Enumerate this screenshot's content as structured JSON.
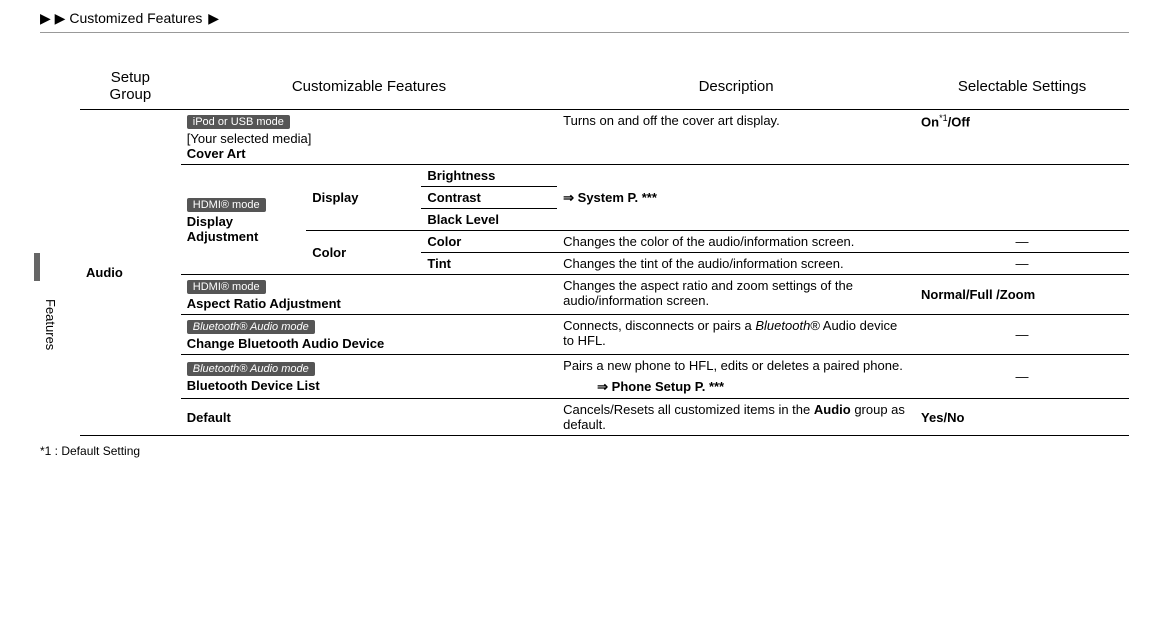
{
  "breadcrumb": {
    "arrows": "▶ ▶",
    "title": "Customized Features",
    "arrow_after": "▶"
  },
  "headers": {
    "setup_group": "Setup\nGroup",
    "customizable": "Customizable Features",
    "description": "Description",
    "selectable": "Selectable Settings"
  },
  "side_tab": "Features",
  "group": "Audio",
  "rows": {
    "cover_art": {
      "badge": "iPod or USB mode",
      "line1": "[Your selected media]",
      "line2": "Cover Art",
      "desc": "Turns on and off the cover art display.",
      "setting_on": "On",
      "setting_sup": "*1",
      "setting_off": "/Off"
    },
    "display_adj": {
      "badge": "HDMI® mode",
      "label": "Display Adjustment",
      "display": "Display",
      "color_group": "Color",
      "brightness": "Brightness",
      "contrast": "Contrast",
      "black_level": "Black Level",
      "color": "Color",
      "tint": "Tint",
      "system_ref": "⇒   System P. ***",
      "color_desc": "Changes the color of the audio/information screen.",
      "tint_desc": "Changes the tint of the audio/information screen.",
      "dash": "—"
    },
    "aspect": {
      "badge": "HDMI® mode",
      "label": "Aspect Ratio Adjustment",
      "desc": "Changes the aspect ratio and zoom settings of the audio/information screen.",
      "setting": "Normal/Full  /Zoom"
    },
    "change_bt": {
      "badge": "Bluetooth® Audio mode",
      "label": "Change Bluetooth Audio Device",
      "desc": "Connects, disconnects or pairs a Bluetooth® Audio device to HFL.",
      "dash": "—"
    },
    "bt_list": {
      "badge": "Bluetooth® Audio mode",
      "label": "Bluetooth Device List",
      "desc": "Pairs a new phone to HFL, edits or deletes a paired phone.",
      "ref": "⇒   Phone Setup P. ***",
      "dash": "—"
    },
    "default": {
      "label": "Default",
      "desc_pre": "Cancels/Resets all customized items in the ",
      "desc_bold": "Audio",
      "desc_post": " group as default.",
      "setting": "Yes/No"
    }
  },
  "footnote": "*1 : Default Setting"
}
